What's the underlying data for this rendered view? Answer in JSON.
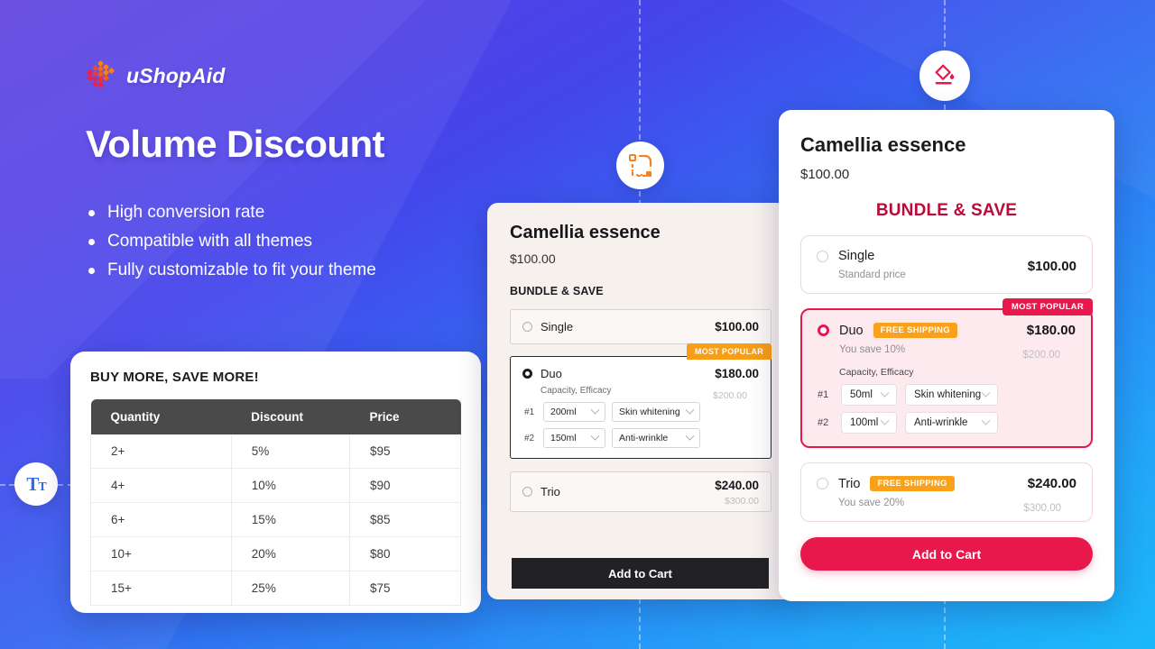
{
  "brand": {
    "name": "uShopAid",
    "logo_icon": "dot-grid-diamond-logo",
    "logo_color": "#e8224a",
    "logo_accent": "#f7811f"
  },
  "hero": {
    "title": "Volume Discount",
    "bullets": [
      "High conversion rate",
      "Compatible with all themes",
      "Fully customizable to fit your theme"
    ]
  },
  "floating_icons": [
    {
      "name": "paint-bucket-icon",
      "color": "#e8174c"
    },
    {
      "name": "shape-corner-radius-icon",
      "color": "#f7811f"
    },
    {
      "name": "typography-icon",
      "color": "#2f6fe4",
      "glyph": "Tt"
    }
  ],
  "table_card": {
    "title": "BUY MORE, SAVE MORE!",
    "headers": [
      "Quantity",
      "Discount",
      "Price"
    ],
    "rows": [
      [
        "2+",
        "5%",
        "$95"
      ],
      [
        "4+",
        "10%",
        "$90"
      ],
      [
        "6+",
        "15%",
        "$85"
      ],
      [
        "10+",
        "20%",
        "$80"
      ],
      [
        "15+",
        "25%",
        "$75"
      ]
    ]
  },
  "mid_card": {
    "product_name": "Camellia essence",
    "product_price": "$100.00",
    "bundle_heading": "BUNDLE & SAVE",
    "most_popular_badge": "MOST POPULAR",
    "options": [
      {
        "label": "Single",
        "price": "$100.00",
        "selected": false
      },
      {
        "label": "Duo",
        "price": "$180.00",
        "compare_at": "$200.00",
        "selected": true,
        "variant_label": "Capacity, Efficacy",
        "variants": [
          {
            "index": "#1",
            "capacity": "200ml",
            "efficacy": "Skin whitening"
          },
          {
            "index": "#2",
            "capacity": "150ml",
            "efficacy": "Anti-wrinkle"
          }
        ]
      },
      {
        "label": "Trio",
        "price": "$240.00",
        "compare_at": "$300.00",
        "selected": false
      }
    ],
    "add_to_cart": "Add to Cart"
  },
  "right_card": {
    "product_name": "Camellia essence",
    "product_price": "$100.00",
    "bundle_heading": "BUNDLE & SAVE",
    "most_popular_badge": "MOST POPULAR",
    "free_shipping_badge": "FREE SHIPPING",
    "accent_color": "#e8174c",
    "options": [
      {
        "label": "Single",
        "price": "$100.00",
        "sub": "Standard price",
        "selected": false
      },
      {
        "label": "Duo",
        "price": "$180.00",
        "compare_at": "$200.00",
        "sub": "You save 10%",
        "selected": true,
        "variant_label": "Capacity, Efficacy",
        "variants": [
          {
            "index": "#1",
            "capacity": "50ml",
            "efficacy": "Skin whitening"
          },
          {
            "index": "#2",
            "capacity": "100ml",
            "efficacy": "Anti-wrinkle"
          }
        ]
      },
      {
        "label": "Trio",
        "price": "$240.00",
        "compare_at": "$300.00",
        "sub": "You save 20%",
        "selected": false
      }
    ],
    "add_to_cart": "Add to Cart"
  }
}
